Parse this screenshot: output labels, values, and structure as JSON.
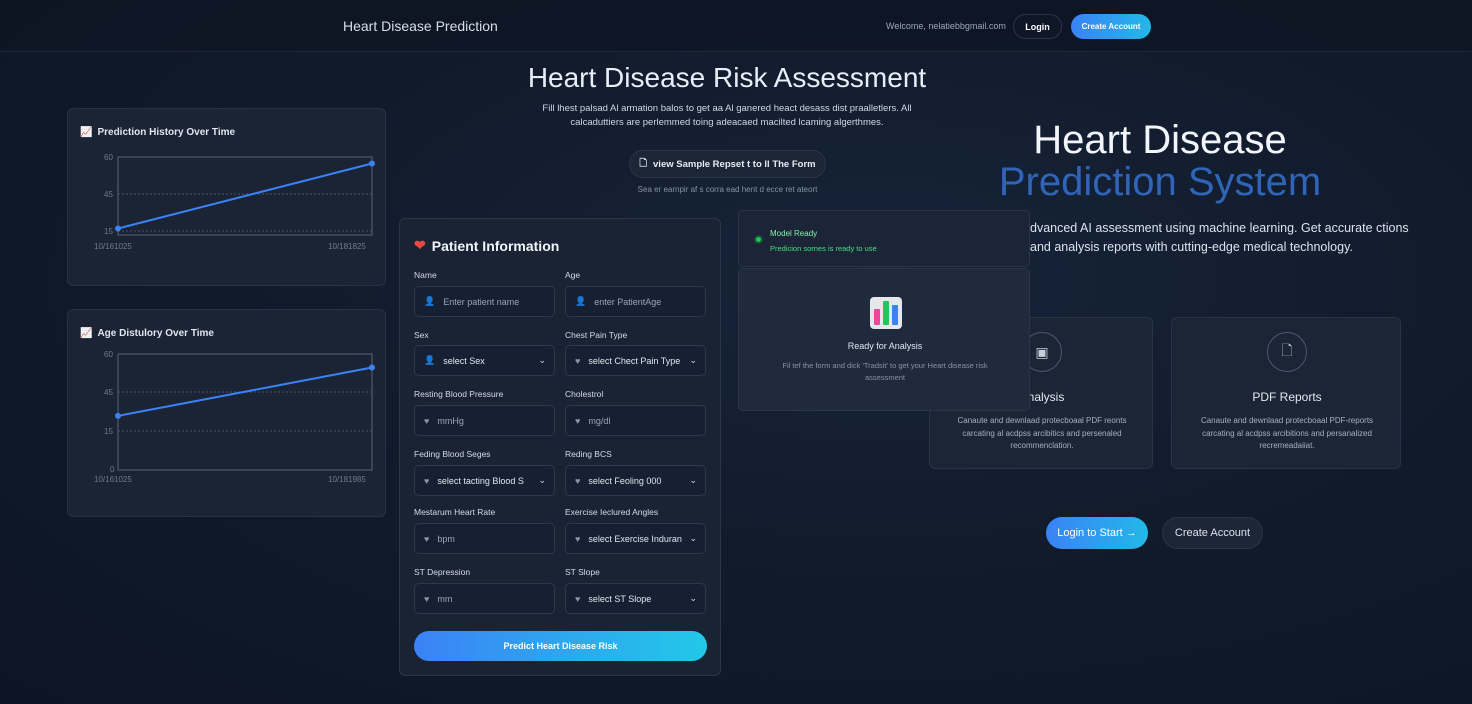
{
  "nav": {
    "brand": "Heart Disease Prediction",
    "welcome": "Welcome, nelatiebbgmail.com",
    "login": "Login",
    "create_account": "Create Account"
  },
  "header": {
    "title": "Heart Disease Risk Assessment",
    "subtitle": "Fill lhest palsad Al armation balos to get aa Al ganered heact desass dist praalletlers. All calcaduttiers are perlemmed toing adeacaed macilted lcaming algerthmes.",
    "sample_button": "view Sample Repset t to ll The Form",
    "sample_hint": "Sea er earnpir af s corra ead hent d ecce ret ateort"
  },
  "charts": {
    "history": {
      "title": "Prediction History Over Time",
      "yticks": [
        "60",
        "45",
        "15"
      ],
      "xticks": [
        "10/161025",
        "10/181825"
      ]
    },
    "age": {
      "title": "Age Distulory Over Time",
      "yticks": [
        "60",
        "45",
        "15",
        "0"
      ],
      "xticks": [
        "10/161025",
        "10/181985"
      ]
    }
  },
  "chart_data": [
    {
      "type": "line",
      "title": "Prediction History Over Time",
      "x": [
        "10/161025",
        "10/181825"
      ],
      "series": [
        {
          "values": [
            5,
            55
          ]
        }
      ],
      "ylim": [
        0,
        60
      ],
      "grid": true
    },
    {
      "type": "line",
      "title": "Age Distulory Over Time",
      "x": [
        "10/161025",
        "10/181985"
      ],
      "series": [
        {
          "values": [
            28,
            53
          ]
        }
      ],
      "ylim": [
        0,
        60
      ],
      "grid": true
    }
  ],
  "form": {
    "title": "Patient Information",
    "fields": {
      "name": {
        "label": "Name",
        "placeholder": "Enter patient name"
      },
      "age": {
        "label": "Age",
        "placeholder": "enter PatientAge"
      },
      "sex": {
        "label": "Sex",
        "value": "select Sex"
      },
      "chest": {
        "label": "Chest Pain Type",
        "value": "select Chect Pain Type"
      },
      "bp": {
        "label": "Resting Blood Pressure",
        "placeholder": "mmHg"
      },
      "chol": {
        "label": "Cholestrol",
        "placeholder": "mg/dl"
      },
      "fbs": {
        "label": "Feding Blood Seges",
        "value": "select tacting Blood S"
      },
      "recg": {
        "label": "Reding BCS",
        "value": "select Feoling 000"
      },
      "hr": {
        "label": "Mestarum Heart Rate",
        "placeholder": "bpm"
      },
      "angina": {
        "label": "Exercise Ieclured Angles",
        "value": "select Exercise Induran"
      },
      "st": {
        "label": "ST Depression",
        "placeholder": "mm"
      },
      "slope": {
        "label": "ST Slope",
        "value": "select ST Slope"
      }
    },
    "predict_button": "Predict Heart Disease Risk"
  },
  "status": {
    "title": "Model Ready",
    "subtitle": "Predicion sornes is ready to use"
  },
  "analysis": {
    "title": "Ready for Analysis",
    "subtitle": "Fil tef the form and dick 'Tradsit' to get your Heart disease risk assessment"
  },
  "hero": {
    "title_line1": "Heart Disease",
    "title_line2": "Prediction System",
    "description": "dvanced AI assessment using machine learning. Get accurate ctions and analysis reports with cutting-edge medical technology."
  },
  "features": [
    {
      "title": "Analysis",
      "desc": "Canaute and dewnlaad protecboaal PDF reonts carcating al acdpss arcibitics and persenaled recommenclation."
    },
    {
      "title": "PDF Reports",
      "desc": "Canaute and dewnlaad protecboaal PDF-reports carcating al acdpss arcibitions and persanalized recremeadaiiat."
    }
  ],
  "cta": {
    "start": "Login to Start →",
    "account": "Create Account"
  },
  "colors": {
    "accent": "#3b82f6",
    "accent_gradient_end": "#22b8e8",
    "line": "#3b82f6",
    "ready": "#22c55e",
    "heart": "#ef4444"
  }
}
